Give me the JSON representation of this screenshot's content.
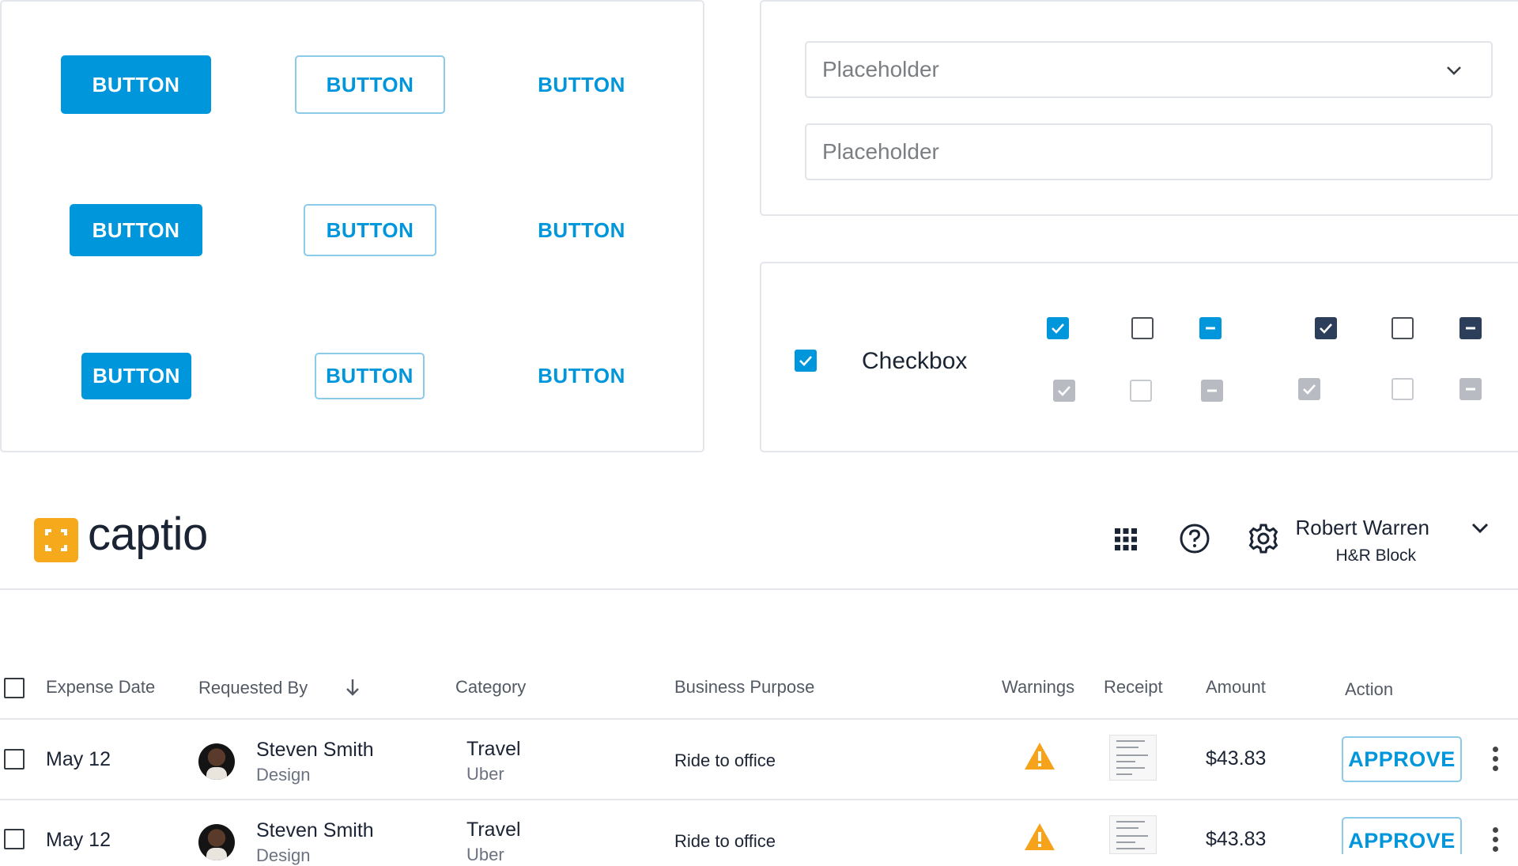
{
  "buttons_panel": {
    "rows": [
      {
        "filled": "BUTTON",
        "outline": "BUTTON",
        "text": "BUTTON"
      },
      {
        "filled": "BUTTON",
        "outline": "BUTTON",
        "text": "BUTTON"
      },
      {
        "filled": "BUTTON",
        "outline": "BUTTON",
        "text": "BUTTON"
      }
    ]
  },
  "inputs_panel": {
    "select": {
      "placeholder": "Placeholder"
    },
    "text_field": {
      "placeholder": "Placeholder"
    }
  },
  "checkbox_panel": {
    "label": "Checkbox",
    "colors": {
      "primary": "#0096db",
      "dark": "#2c3e5a",
      "disabled": "#b8bcc2"
    }
  },
  "header": {
    "brand": "captio",
    "brand_color": "#f7a91c",
    "icons": [
      "apps-grid-icon",
      "help-icon",
      "settings-gear-icon"
    ],
    "user": {
      "name": "Robert Warren",
      "org": "H&R Block"
    }
  },
  "table": {
    "columns": {
      "expense_date": "Expense Date",
      "requested_by": "Requested By",
      "category": "Category",
      "business_purpose": "Business Purpose",
      "warnings": "Warnings",
      "receipt": "Receipt",
      "amount": "Amount",
      "action": "Action"
    },
    "rows": [
      {
        "date": "May 12",
        "name": "Steven Smith",
        "dept": "Design",
        "category": "Travel",
        "vendor": "Uber",
        "purpose": "Ride to office",
        "amount": "$43.83",
        "action": "APPROVE"
      },
      {
        "date": "May 12",
        "name": "Steven Smith",
        "dept": "Design",
        "category": "Travel",
        "vendor": "Uber",
        "purpose": "Ride to office",
        "amount": "$43.83",
        "action": "APPROVE"
      }
    ]
  }
}
